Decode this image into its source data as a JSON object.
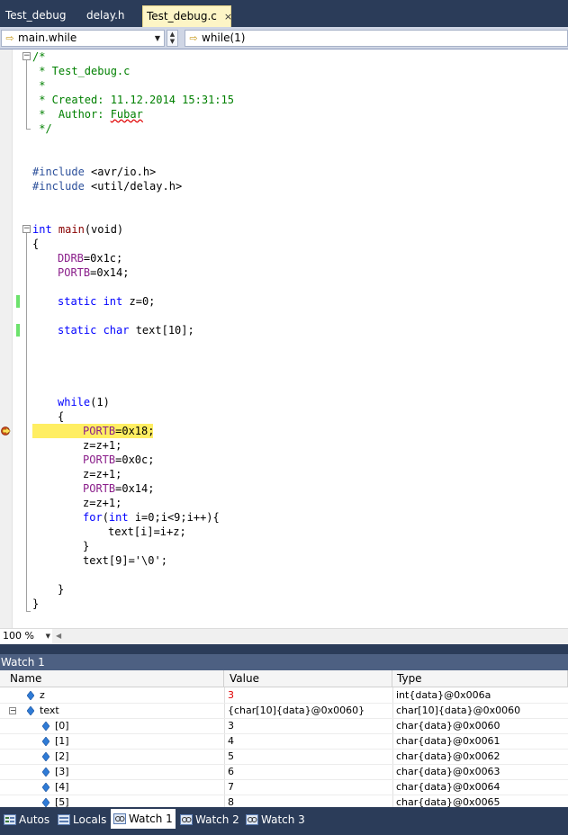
{
  "tabs": [
    {
      "label": "Test_debug",
      "active": false
    },
    {
      "label": "delay.h",
      "active": false
    },
    {
      "label": "Test_debug.c",
      "active": true,
      "close": "×"
    }
  ],
  "navbar": {
    "scope_combo": "main.while",
    "member_combo": "while(1)",
    "split_up": "▲",
    "split_down": "▼"
  },
  "code": {
    "lines": {
      "l1": "/*",
      "l2": " * Test_debug.c",
      "l3": " *",
      "l4": " * Created: 11.12.2014 15:31:15",
      "l5a": " *  Author: ",
      "l5b": "Fubar",
      "l6": " */",
      "inc1a": "#include",
      "inc1b": " <avr/io.h>",
      "inc2a": "#include",
      "inc2b": " <util/delay.h>",
      "m1": "int",
      "m2": " main",
      "m3": "(void)",
      "brace_open": "{",
      "ddrb": "DDRB",
      "ddrb_v": "=0x1c;",
      "portb1": "PORTB",
      "portb1_v": "=0x14;",
      "static1": "static",
      "int1": " int",
      "z_decl": " z=0;",
      "static2": "static",
      "char1": " char",
      "text_decl": " text[10];",
      "while_kw": "while",
      "while_rest": "(1)",
      "inner_open": "{",
      "cur_portb": "PORTB",
      "cur_v": "=0x18;",
      "zinc1": "z=z+1;",
      "portb3": "PORTB",
      "portb3_v": "=0x0c;",
      "zinc2": "z=z+1;",
      "portb4": "PORTB",
      "portb4_v": "=0x14;",
      "zinc3": "z=z+1;",
      "for_kw": "for",
      "for_p1": "(",
      "for_int": "int",
      "for_rest": " i=0;i<9;i++){",
      "text_assign": "text[i]=i+z;",
      "for_close": "}",
      "text9": "text[9]='\\0';",
      "inner_close": "}",
      "brace_close": "}"
    }
  },
  "zoom": {
    "level": "100 %"
  },
  "watch": {
    "title": "Watch 1",
    "columns": [
      "Name",
      "Value",
      "Type"
    ],
    "rows": [
      {
        "name": "z",
        "value": "3",
        "type": "int{data}@0x006a",
        "changed": true
      },
      {
        "name": "text",
        "value": "{char[10]{data}@0x0060}",
        "type": "char[10]{data}@0x0060",
        "expanded": true
      },
      {
        "name": "[0]",
        "value": "3",
        "type": "char{data}@0x0060"
      },
      {
        "name": "[1]",
        "value": "4",
        "type": "char{data}@0x0061"
      },
      {
        "name": "[2]",
        "value": "5",
        "type": "char{data}@0x0062"
      },
      {
        "name": "[3]",
        "value": "6",
        "type": "char{data}@0x0063"
      },
      {
        "name": "[4]",
        "value": "7",
        "type": "char{data}@0x0064"
      },
      {
        "name": "[5]",
        "value": "8",
        "type": "char{data}@0x0065"
      }
    ]
  },
  "bottom_tabs": [
    "Autos",
    "Locals",
    "Watch 1",
    "Watch 2",
    "Watch 3"
  ],
  "colors": {
    "accent": "#2b3c59",
    "current_line": "#ffee62",
    "changed_value": "#e00000"
  }
}
